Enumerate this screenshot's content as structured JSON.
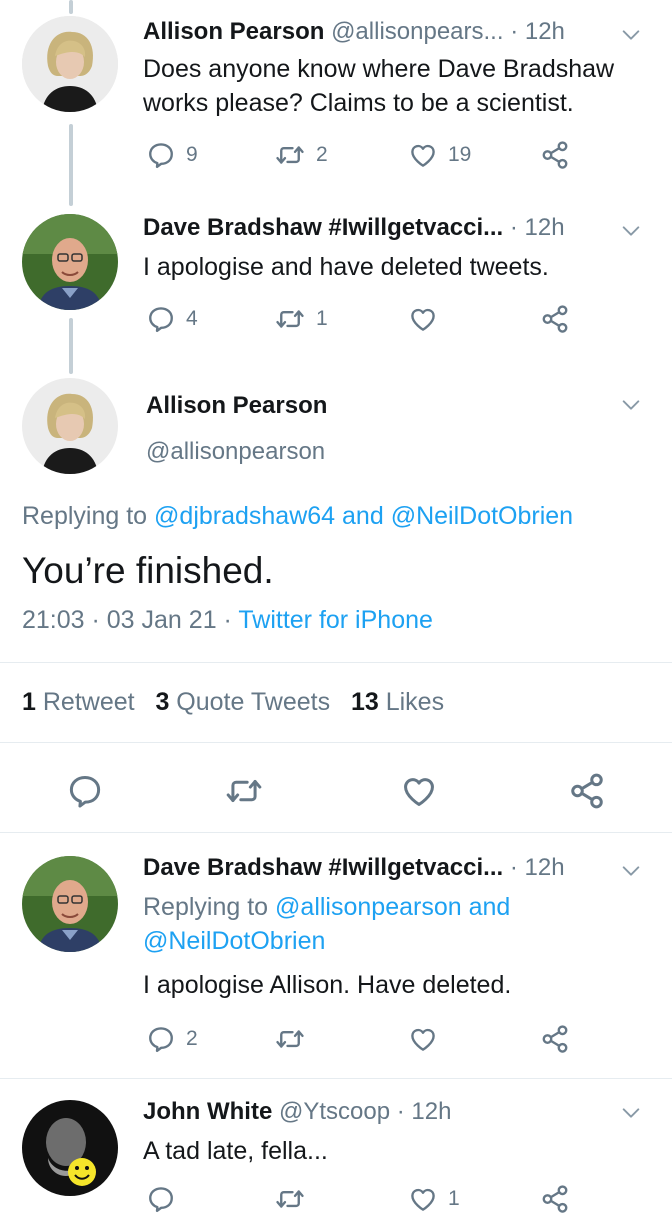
{
  "tweets": [
    {
      "name": "Allison Pearson",
      "handle": "@allisonpears...",
      "time": "· 12h",
      "text_line1": "Does anyone know where Dave Bradshaw",
      "text_line2": "works please? Claims to be a scientist.",
      "replies": "9",
      "retweets": "2",
      "likes": "19"
    },
    {
      "name": "Dave Bradshaw #Iwillgetvacci...",
      "time": "· 12h",
      "text": "I apologise and have deleted tweets.",
      "replies": "4",
      "retweets": "1",
      "likes": ""
    }
  ],
  "focus": {
    "name": "Allison Pearson",
    "handle": "@allisonpearson",
    "replying_prefix": "Replying to",
    "replying_user1": "@djbradshaw64",
    "replying_and": "and",
    "replying_user2": "@NeilDotObrien",
    "text": "You’re finished.",
    "datetime": "21:03 · 03 Jan 21 ·",
    "source": "Twitter for iPhone",
    "retweet_count": "1",
    "retweet_label": "Retweet",
    "quote_count": "3",
    "quote_label": "Quote Tweets",
    "like_count": "13",
    "like_label": "Likes"
  },
  "replies": [
    {
      "name": "Dave Bradshaw #Iwillgetvacci...",
      "time": "· 12h",
      "replying_prefix": "Replying to",
      "replying_user1": "@allisonpearson",
      "replying_and": "and",
      "replying_user2": "@NeilDotObrien",
      "text": "I apologise Allison. Have deleted.",
      "replies": "2",
      "retweets": "",
      "likes": ""
    },
    {
      "name": "John White",
      "handle": "@Ytscoop",
      "time": "· 12h",
      "text": "A tad late, fella...",
      "likes": "1"
    }
  ],
  "colors": {
    "accent": "#1da1f2",
    "muted": "#657786",
    "text": "#14171a",
    "divider": "#e6ecf0"
  },
  "icons": [
    "reply-icon",
    "retweet-icon",
    "like-icon",
    "share-icon",
    "chevron-down-icon"
  ]
}
